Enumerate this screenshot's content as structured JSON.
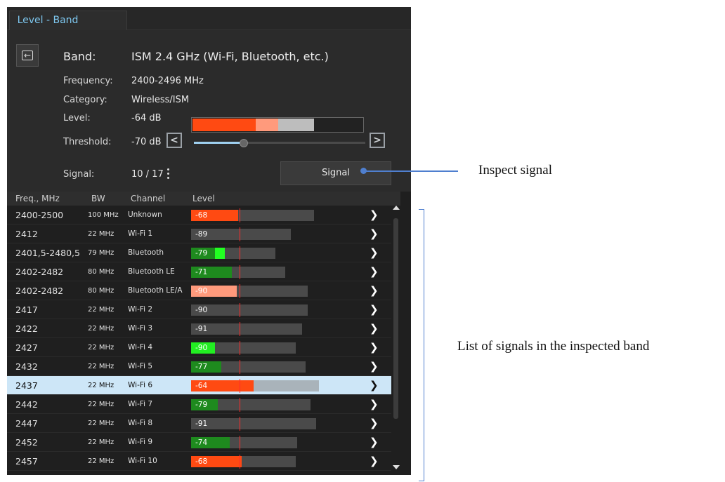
{
  "tab": {
    "label": "Level - Band"
  },
  "band": {
    "band_label": "Band:",
    "band_value": "ISM 2.4 GHz (Wi-Fi, Bluetooth, etc.)",
    "frequency_label": "Frequency:",
    "frequency_value": "2400-2496 MHz",
    "category_label": "Category:",
    "category_value": "Wireless/ISM",
    "level_label": "Level:",
    "level_value": "-64 dB",
    "level_bar": {
      "red_fraction": 0.37,
      "salmon_fraction": 0.13,
      "gray_fraction": 0.21,
      "colors": {
        "red": "#ff4a12",
        "salmon": "#ff9a7c",
        "gray": "#bdbdbd"
      }
    },
    "threshold_label": "Threshold:",
    "threshold_value": "-70 dB",
    "threshold_slider_fraction": 0.29,
    "signal_label": "Signal:",
    "signal_value": "10 / 17",
    "signal_button": "Signal"
  },
  "table": {
    "headers": {
      "freq": "Freq., MHz",
      "bw": "BW",
      "channel": "Channel",
      "level": "Level"
    },
    "rows": [
      {
        "freq": "2400-2500",
        "bw": "100 MHz",
        "channel": "Unknown",
        "level": "-68",
        "fill_color": "#ff4a12",
        "level_fraction": 0.28,
        "range_fraction": 0.73
      },
      {
        "freq": "2412",
        "bw": "22 MHz",
        "channel": "Wi-Fi 1",
        "level": "-89",
        "fill_color": "",
        "level_fraction": 0,
        "range_fraction": 0.59
      },
      {
        "freq": "2401,5-2480,5",
        "bw": "79 MHz",
        "channel": "Bluetooth",
        "level": "-79",
        "fill_color": "#1e8a1e",
        "level_fraction": 0.2,
        "range_fraction": 0.5,
        "peak_color": "#22ff22",
        "peak_fraction": 0.06
      },
      {
        "freq": "2402-2482",
        "bw": "80 MHz",
        "channel": "Bluetooth LE",
        "level": "-71",
        "fill_color": "#1e8a1e",
        "level_fraction": 0.24,
        "range_fraction": 0.56
      },
      {
        "freq": "2402-2482",
        "bw": "80 MHz",
        "channel": "Bluetooth LE/A",
        "level": "-90",
        "fill_color": "#ff9a7c",
        "level_fraction": 0.27,
        "range_fraction": 0.69
      },
      {
        "freq": "2417",
        "bw": "22 MHz",
        "channel": "Wi-Fi 2",
        "level": "-90",
        "fill_color": "",
        "level_fraction": 0,
        "range_fraction": 0.69
      },
      {
        "freq": "2422",
        "bw": "22 MHz",
        "channel": "Wi-Fi 3",
        "level": "-91",
        "fill_color": "",
        "level_fraction": 0,
        "range_fraction": 0.66
      },
      {
        "freq": "2427",
        "bw": "22 MHz",
        "channel": "Wi-Fi 4",
        "level": "-90",
        "fill_color": "#22ee22",
        "level_fraction": 0.14,
        "range_fraction": 0.62
      },
      {
        "freq": "2432",
        "bw": "22 MHz",
        "channel": "Wi-Fi 5",
        "level": "-77",
        "fill_color": "#1e8a1e",
        "level_fraction": 0.18,
        "range_fraction": 0.68
      },
      {
        "freq": "2437",
        "bw": "22 MHz",
        "channel": "Wi-Fi 6",
        "level": "-64",
        "fill_color": "#ff4a12",
        "level_fraction": 0.37,
        "range_fraction": 0.76,
        "selected": true
      },
      {
        "freq": "2442",
        "bw": "22 MHz",
        "channel": "Wi-Fi 7",
        "level": "-79",
        "fill_color": "#1e8a1e",
        "level_fraction": 0.16,
        "range_fraction": 0.71
      },
      {
        "freq": "2447",
        "bw": "22 MHz",
        "channel": "Wi-Fi 8",
        "level": "-91",
        "fill_color": "",
        "level_fraction": 0,
        "range_fraction": 0.74
      },
      {
        "freq": "2452",
        "bw": "22 MHz",
        "channel": "Wi-Fi 9",
        "level": "-74",
        "fill_color": "#1e8a1e",
        "level_fraction": 0.23,
        "range_fraction": 0.63
      },
      {
        "freq": "2457",
        "bw": "22 MHz",
        "channel": "Wi-Fi 10",
        "level": "-68",
        "fill_color": "#ff4a12",
        "level_fraction": 0.3,
        "range_fraction": 0.62
      }
    ]
  },
  "icons": {
    "back": "arrow-left-icon",
    "prev": "chevron-left-icon",
    "next": "chevron-right-icon",
    "more": "more-vertical-icon",
    "row_chevron": "chevron-right-icon"
  },
  "annotations": {
    "inspect": "Inspect signal",
    "list": "List of signals in the inspected band"
  },
  "colors": {
    "accent": "#7ec8f0",
    "callout": "#4f7fcf",
    "threshold_marker": "#ff2a2a",
    "selected_row": "#cde6f7"
  }
}
